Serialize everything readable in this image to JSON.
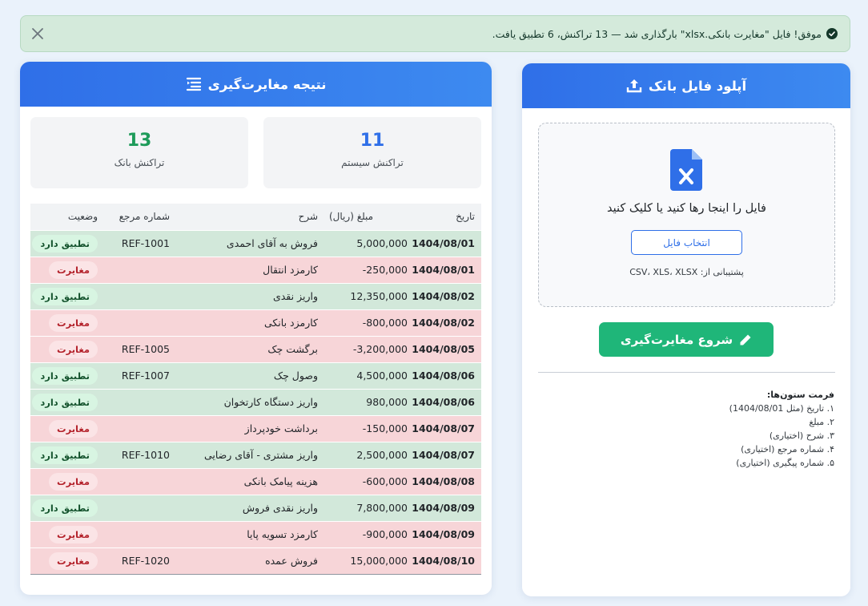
{
  "alert": {
    "message": "موفق! فایل \"مغایرت بانکی.xlsx\" بارگذاری شد — 13 تراکنش، 6 تطبیق یافت.",
    "success_color": "#14372a"
  },
  "upload": {
    "title": "آپلود فایل بانک",
    "drop_text": "فایل را اینجا رها کنید یا کلیک کنید",
    "choose_button": "انتخاب فایل",
    "support_text": "پشتیبانی از: CSV، XLS، XLSX",
    "start_button": "شروع مغایرت‌گیری",
    "format_title": "فرمت ستون‌ها:",
    "format_items": [
      "۱. تاریخ (مثل 1404/08/01)",
      "۲. مبلغ",
      "۳. شرح (اختیاری)",
      "۴. شماره مرجع (اختیاری)",
      "۵. شماره پیگیری (اختیاری)"
    ]
  },
  "result": {
    "title": "نتیجه مغایرت‌گیری",
    "system_count": "11",
    "system_label": "تراکنش سیستم",
    "bank_count": "13",
    "bank_label": "تراکنش بانک",
    "columns": [
      "تاریخ",
      "مبلغ (ریال)",
      "شرح",
      "شماره مرجع",
      "وضعیت"
    ],
    "rows": [
      {
        "date": "1404/08/01",
        "amount": "5,000,000",
        "desc": "فروش به آقای احمدی",
        "ref": "REF-1001",
        "status": "تطبیق دارد",
        "type": "match"
      },
      {
        "date": "1404/08/01",
        "amount": "-250,000",
        "desc": "کارمزد انتقال",
        "ref": "",
        "status": "مغایرت",
        "type": "mismatch"
      },
      {
        "date": "1404/08/02",
        "amount": "12,350,000",
        "desc": "واریز نقدی",
        "ref": "",
        "status": "تطبیق دارد",
        "type": "match"
      },
      {
        "date": "1404/08/02",
        "amount": "-800,000",
        "desc": "کارمزد بانکی",
        "ref": "",
        "status": "مغایرت",
        "type": "mismatch"
      },
      {
        "date": "1404/08/05",
        "amount": "-3,200,000",
        "desc": "برگشت چک",
        "ref": "REF-1005",
        "status": "مغایرت",
        "type": "mismatch"
      },
      {
        "date": "1404/08/06",
        "amount": "4,500,000",
        "desc": "وصول چک",
        "ref": "REF-1007",
        "status": "تطبیق دارد",
        "type": "match"
      },
      {
        "date": "1404/08/06",
        "amount": "980,000",
        "desc": "واریز دستگاه کارتخوان",
        "ref": "",
        "status": "تطبیق دارد",
        "type": "match"
      },
      {
        "date": "1404/08/07",
        "amount": "-150,000",
        "desc": "برداشت خودپرداز",
        "ref": "",
        "status": "مغایرت",
        "type": "mismatch"
      },
      {
        "date": "1404/08/07",
        "amount": "2,500,000",
        "desc": "واریز مشتری - آقای رضایی",
        "ref": "REF-1010",
        "status": "تطبیق دارد",
        "type": "match"
      },
      {
        "date": "1404/08/08",
        "amount": "-600,000",
        "desc": "هزینه پیامک بانکی",
        "ref": "",
        "status": "مغایرت",
        "type": "mismatch"
      },
      {
        "date": "1404/08/09",
        "amount": "7,800,000",
        "desc": "واریز نقدی فروش",
        "ref": "",
        "status": "تطبیق دارد",
        "type": "match"
      },
      {
        "date": "1404/08/09",
        "amount": "-900,000",
        "desc": "کارمزد تسویه پایا",
        "ref": "",
        "status": "مغایرت",
        "type": "mismatch"
      },
      {
        "date": "1404/08/10",
        "amount": "15,000,000",
        "desc": "فروش عمده",
        "ref": "REF-1020",
        "status": "مغایرت",
        "type": "mismatch"
      }
    ]
  },
  "colors": {
    "header_blue": "#2f6fe8",
    "match_row": "#d2e8da",
    "mismatch_row": "#f7d5d8",
    "start_green": "#1fb679"
  }
}
